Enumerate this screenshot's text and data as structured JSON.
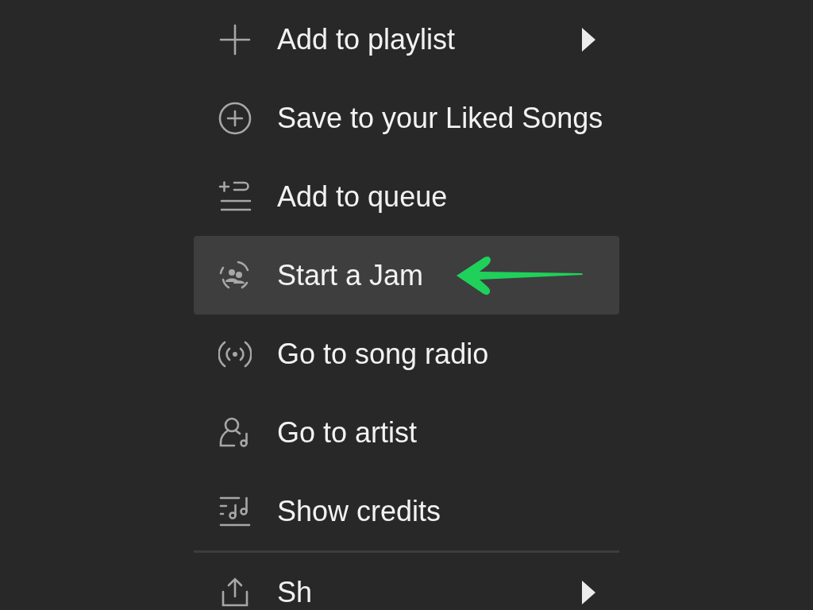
{
  "menu": {
    "sections": [
      {
        "items": [
          {
            "label": "Add to playlist",
            "submenu": true,
            "selected": false,
            "pointed_by_arrow": false
          },
          {
            "label": "Save to your Liked Songs",
            "submenu": false,
            "selected": false,
            "pointed_by_arrow": false
          },
          {
            "label": "Add to queue",
            "submenu": false,
            "selected": false,
            "pointed_by_arrow": false
          },
          {
            "label": "Start a Jam",
            "submenu": false,
            "selected": true,
            "pointed_by_arrow": true
          },
          {
            "label": "Go to song radio",
            "submenu": false,
            "selected": false,
            "pointed_by_arrow": false
          },
          {
            "label": "Go to artist",
            "submenu": false,
            "selected": false,
            "pointed_by_arrow": false
          },
          {
            "label": "Show credits",
            "submenu": false,
            "selected": false,
            "pointed_by_arrow": false
          }
        ]
      },
      {
        "items": [
          {
            "label": "Sh",
            "submenu": true,
            "selected": false,
            "pointed_by_arrow": false
          }
        ]
      }
    ]
  }
}
